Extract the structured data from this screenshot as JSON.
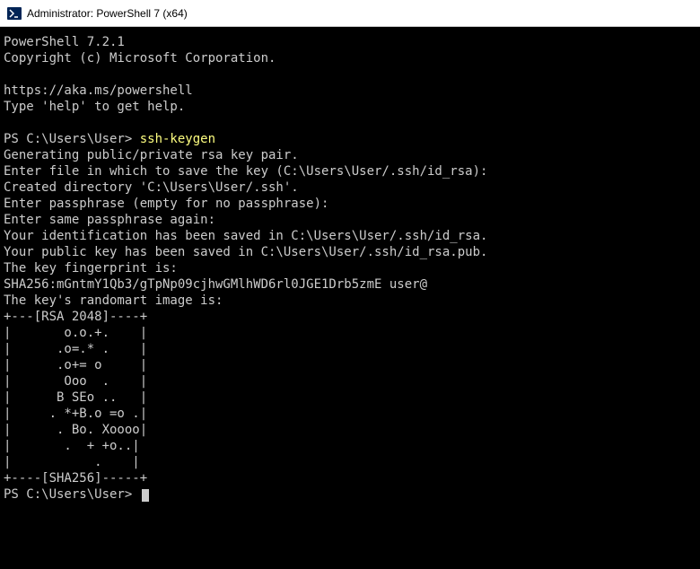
{
  "titlebar": {
    "text": "Administrator: PowerShell 7 (x64)"
  },
  "terminal": {
    "header1": "PowerShell 7.2.1",
    "header2": "Copyright (c) Microsoft Corporation.",
    "url": "https://aka.ms/powershell",
    "helptext": "Type 'help' to get help.",
    "prompt1": "PS C:\\Users\\User> ",
    "cmd1": "ssh-keygen",
    "line1": "Generating public/private rsa key pair.",
    "line2": "Enter file in which to save the key (C:\\Users\\User/.ssh/id_rsa):",
    "line3": "Created directory 'C:\\Users\\User/.ssh'.",
    "line4": "Enter passphrase (empty for no passphrase):",
    "line5": "Enter same passphrase again:",
    "line6": "Your identification has been saved in C:\\Users\\User/.ssh/id_rsa.",
    "line7": "Your public key has been saved in C:\\Users\\User/.ssh/id_rsa.pub.",
    "line8": "The key fingerprint is:",
    "line9": "SHA256:mGntmY1Qb3/gTpNp09cjhwGMlhWD6rl0JGE1Drb5zmE user@",
    "line10": "The key's randomart image is:",
    "art1": "+---[RSA 2048]----+",
    "art2": "|       o.o.+.    |",
    "art3": "|      .o=.* .    |",
    "art4": "|      .o+= o     |",
    "art5": "|       Ooo  .    |",
    "art6": "|      B SEo ..   |",
    "art7": "|     . *+B.o =o .|",
    "art8": "|      . Bo. Xoooo|",
    "art9": "|       .  + +o..|",
    "art10": "|           .    |",
    "art11": "+----[SHA256]-----+",
    "prompt2": "PS C:\\Users\\User> "
  }
}
